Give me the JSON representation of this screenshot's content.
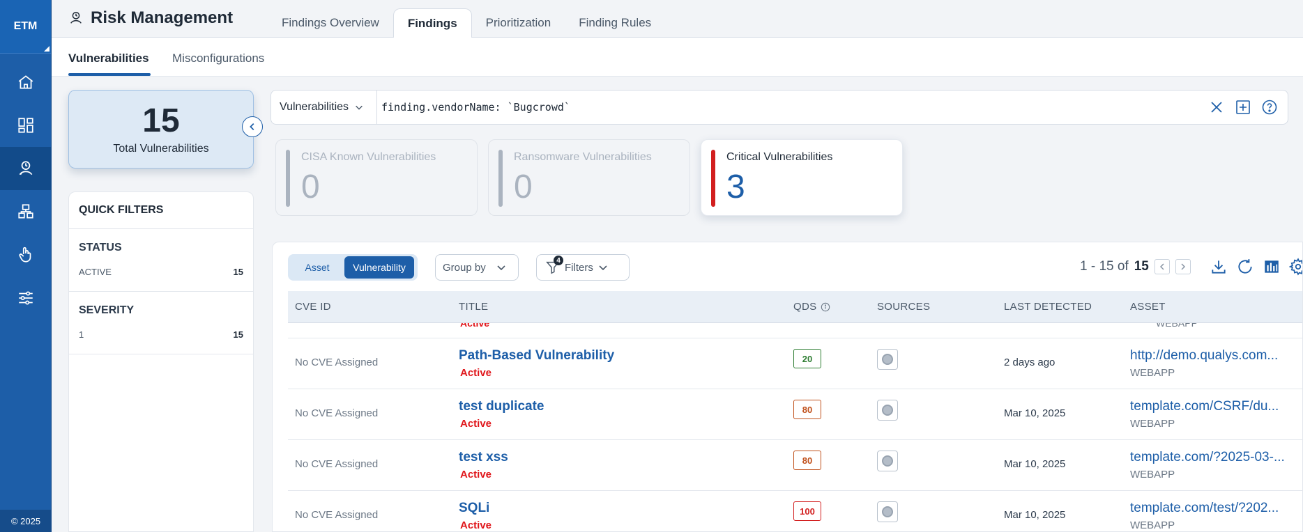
{
  "app": {
    "logo": "ETM",
    "title": "Risk Management",
    "copyright": "© 2025",
    "colors": {
      "primary": "#1d5ea8",
      "critical": "#d21f1f",
      "active_status": "#e0161b"
    }
  },
  "nav_rail": [
    {
      "icon": "home-icon"
    },
    {
      "icon": "dashboard-icon"
    },
    {
      "icon": "risk-management-icon",
      "active": true
    },
    {
      "icon": "assets-icon"
    },
    {
      "icon": "touch-icon"
    },
    {
      "icon": "settings-sliders-icon"
    }
  ],
  "tabs": [
    "Findings Overview",
    "Findings",
    "Prioritization",
    "Finding Rules"
  ],
  "active_tab": "Findings",
  "subtabs": [
    "Vulnerabilities",
    "Misconfigurations"
  ],
  "active_subtab": "Vulnerabilities",
  "summary": {
    "total": "15",
    "label": "Total Vulnerabilities"
  },
  "quick_filters": {
    "title": "QUICK FILTERS",
    "sections": [
      {
        "title": "STATUS",
        "item": "ACTIVE",
        "count": "15"
      },
      {
        "title": "SEVERITY",
        "item": "1",
        "count": "15"
      }
    ]
  },
  "search": {
    "type": "Vulnerabilities",
    "query": "finding.vendorName: `Bugcrowd`"
  },
  "stats": [
    {
      "label": "CISA Known Vulnerabilities",
      "value": "0",
      "enabled": false
    },
    {
      "label": "Ransomware Vulnerabilities",
      "value": "0",
      "enabled": false
    },
    {
      "label": "Critical Vulnerabilities",
      "value": "3",
      "enabled": true
    }
  ],
  "toolbar": {
    "toggle_asset": "Asset",
    "toggle_vulnerability": "Vulnerability",
    "group_by": "Group by",
    "filters": "Filters",
    "filter_count": "4",
    "pager_range": "1 - 15 of",
    "pager_total": "15"
  },
  "columns": [
    "CVE ID",
    "TITLE",
    "QDS",
    "SOURCES",
    "LAST DETECTED",
    "ASSET"
  ],
  "partial_row": {
    "status": "Active",
    "asset_type": "WEBAPP"
  },
  "rows": [
    {
      "cve": "No CVE Assigned",
      "title": "Path-Based Vulnerability",
      "status": "Active",
      "qds": "20",
      "qds_color": "#2e7d32",
      "last_detected": "2 days ago",
      "asset": "http://demo.qualys.com...",
      "asset_type": "WEBAPP"
    },
    {
      "cve": "No CVE Assigned",
      "title": "test duplicate",
      "status": "Active",
      "qds": "80",
      "qds_color": "#c0501b",
      "last_detected": "Mar 10, 2025",
      "asset": "template.com/CSRF/du...",
      "asset_type": "WEBAPP"
    },
    {
      "cve": "No CVE Assigned",
      "title": "test xss",
      "status": "Active",
      "qds": "80",
      "qds_color": "#c0501b",
      "last_detected": "Mar 10, 2025",
      "asset": "template.com/?2025-03-...",
      "asset_type": "WEBAPP"
    },
    {
      "cve": "No CVE Assigned",
      "title": "SQLi",
      "status": "Active",
      "qds": "100",
      "qds_color": "#d21f1f",
      "last_detected": "Mar 10, 2025",
      "asset": "template.com/test/?202...",
      "asset_type": "WEBAPP"
    }
  ]
}
